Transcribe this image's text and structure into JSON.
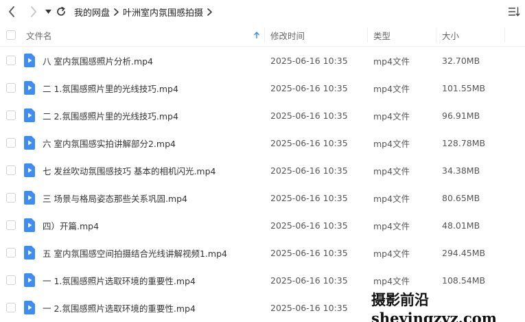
{
  "breadcrumbs": [
    "我的网盘",
    "叶洲室内氛围感拍摄"
  ],
  "columns": {
    "name": "文件名",
    "modified": "修改时间",
    "type": "类型",
    "size": "大小"
  },
  "files": [
    {
      "name": "八 室内氛围感照片分析.mp4",
      "modified": "2025-06-16 10:35",
      "type": "mp4文件",
      "size": "32.70MB"
    },
    {
      "name": "二 1.氛围感照片里的光线技巧.mp4",
      "modified": "2025-06-16 10:35",
      "type": "mp4文件",
      "size": "101.55MB"
    },
    {
      "name": "二 2.氛围感照片里的光线技巧.mp4",
      "modified": "2025-06-16 10:35",
      "type": "mp4文件",
      "size": "96.91MB"
    },
    {
      "name": "六 室内氛围感实拍讲解部分2.mp4",
      "modified": "2025-06-16 10:35",
      "type": "mp4文件",
      "size": "128.78MB"
    },
    {
      "name": "七 发丝吹动氛围感技巧 基本的相机闪光.mp4",
      "modified": "2025-06-16 10:35",
      "type": "mp4文件",
      "size": "34.38MB"
    },
    {
      "name": "三 场景与格局姿态那些关系巩固.mp4",
      "modified": "2025-06-16 10:35",
      "type": "mp4文件",
      "size": "80.65MB"
    },
    {
      "name": "四）开篇.mp4",
      "modified": "2025-06-16 10:35",
      "type": "mp4文件",
      "size": "48.01MB"
    },
    {
      "name": "五 室内氛围感空间拍摄结合光线讲解视频1.mp4",
      "modified": "2025-06-16 10:35",
      "type": "mp4文件",
      "size": "294.45MB"
    },
    {
      "name": "一 1.氛围感照片选取环境的重要性.mp4",
      "modified": "2025-06-16 10:35",
      "type": "mp4文件",
      "size": "108.54MB"
    },
    {
      "name": "一 2.氛围感照片选取环境的重要性.mp4",
      "modified": "2025-06-16 10:35",
      "type": "",
      "size": ""
    }
  ],
  "watermark": "摄影前沿 sheyingzyz.com",
  "colors": {
    "file_icon": "#3d8ef0",
    "divider": "#eceef2",
    "sort_arrow": "#3d8ef0"
  },
  "icons": {
    "back": "chevron-left-icon",
    "forward": "chevron-right-icon",
    "dropdown": "caret-down-icon",
    "refresh": "refresh-icon",
    "sort": "sort-menu-icon",
    "file": "video-file-icon"
  }
}
